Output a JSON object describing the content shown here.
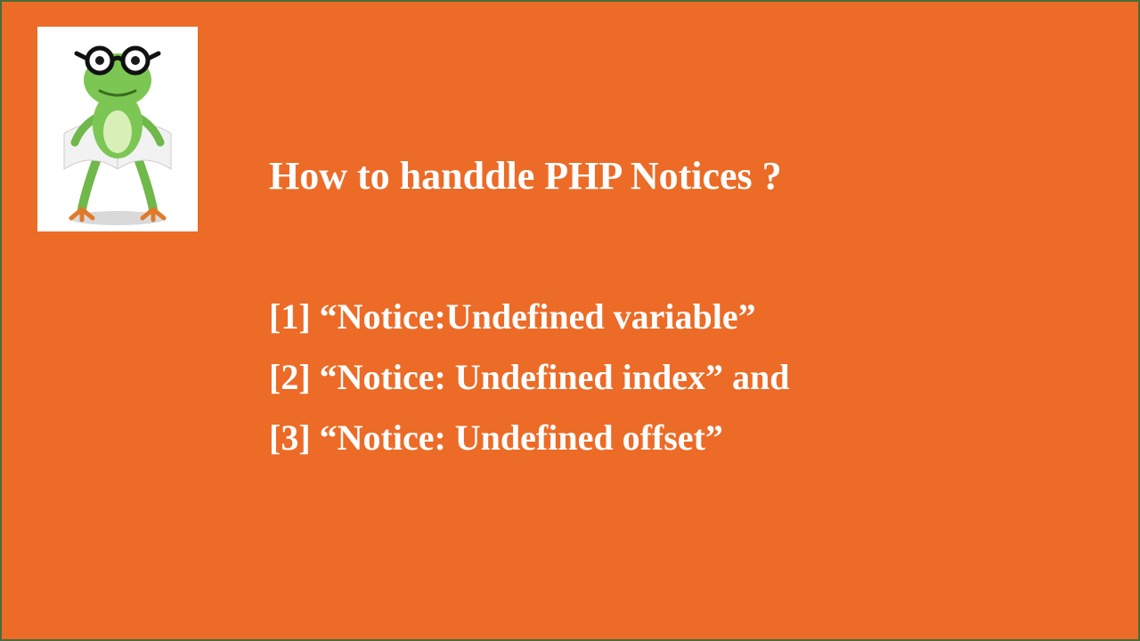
{
  "title": "How to handdle PHP Notices ?",
  "items": [
    "[1]  “Notice:Undefined variable”",
    "[2] “Notice: Undefined index” and",
    "[3] “Notice: Undefined offset”"
  ],
  "avatar_alt": "frog-mascot"
}
